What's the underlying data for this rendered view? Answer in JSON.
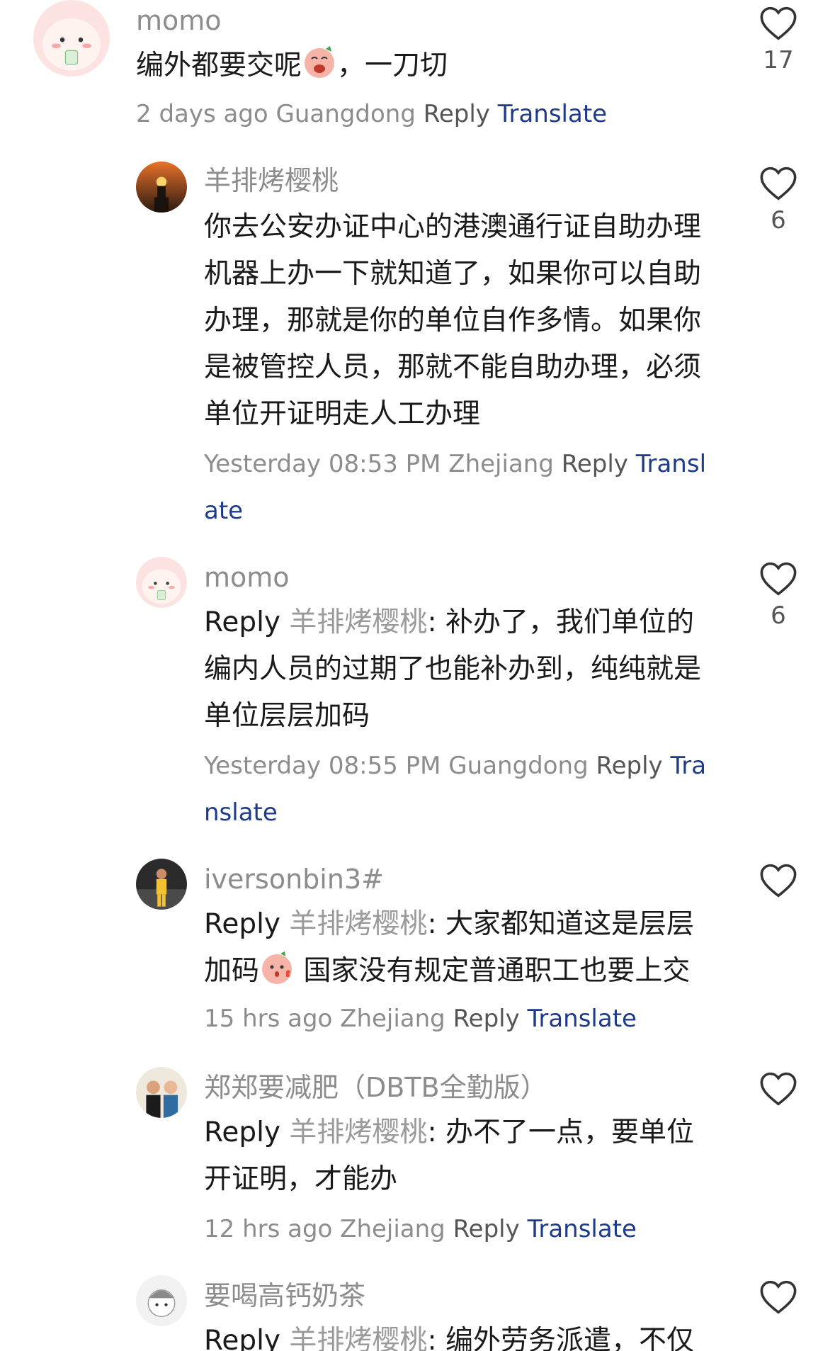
{
  "comments": [
    {
      "user": "momo",
      "text": "编外都要交呢",
      "text_after": "，一刀切",
      "time_location": "2 days ago Guangdong",
      "reply_label": "Reply",
      "translate_label": "Translate",
      "likes": "17"
    },
    {
      "user": "羊排烤樱桃",
      "text": "你去公安办证中心的港澳通行证自助办理机器上办一下就知道了，如果你可以自助办理，那就是你的单位自作多情。如果你是被管控人员，那就不能自助办理，必须单位开证明走人工办理",
      "time_location": "Yesterday 08:53 PM Zhejiang",
      "reply_label": "Reply",
      "translate_label": "Transl",
      "translate_label_2": "ate",
      "likes": "6"
    },
    {
      "user": "momo",
      "reply_prefix": "Reply",
      "reply_to": "羊排烤樱桃",
      "text": ": 补办了，我们单位的编内人员的过期了也能补办到，纯纯就是单位层层加码",
      "time_location": "Yesterday 08:55 PM Guangdong",
      "reply_label": "Reply",
      "translate_label": "Tra",
      "translate_label_2": "nslate",
      "likes": "6"
    },
    {
      "user": "iversonbin3#",
      "reply_prefix": "Reply",
      "reply_to": "羊排烤樱桃",
      "text": ": 大家都知道这是层层加码",
      "text_after": " 国家没有规定普通职工也要上交",
      "time_location": "15 hrs ago Zhejiang",
      "reply_label": "Reply",
      "translate_label": "Translate"
    },
    {
      "user": "郑郑要减肥（DBTB全勤版）",
      "reply_prefix": "Reply",
      "reply_to": "羊排烤樱桃",
      "text": ": 办不了一点，要单位开证明，才能办",
      "time_location": "12 hrs ago Zhejiang",
      "reply_label": "Reply",
      "translate_label": "Translate"
    },
    {
      "user": "要喝高钙奶茶",
      "reply_prefix": "Reply",
      "reply_to": "羊排烤樱桃",
      "text": ": 编外劳务派遣，不仅"
    }
  ],
  "icons": {
    "like": "heart-outline-icon",
    "emoji_1": "crying-face-emoji",
    "emoji_2": "kissing-face-emoji"
  },
  "colors": {
    "link": "#1e3a8a",
    "muted": "#8c8c8c",
    "text": "#1a1a1a"
  }
}
